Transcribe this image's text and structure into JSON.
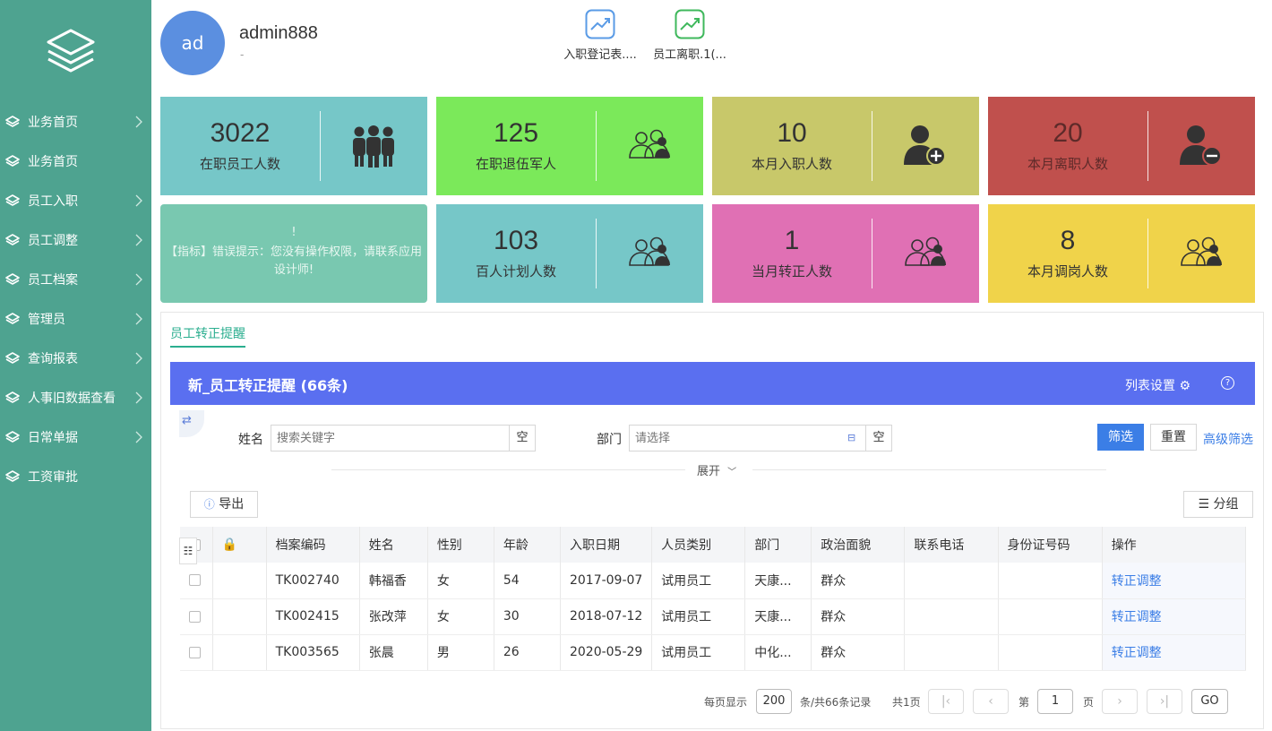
{
  "user": {
    "avatar_text": "ad",
    "name": "admin888",
    "sub": "-"
  },
  "shortcuts": [
    {
      "label": "入职登记表...."
    },
    {
      "label": "员工离职.1(..."
    }
  ],
  "sidebar": {
    "items": [
      {
        "label": "业务首页",
        "has_arrow": true
      },
      {
        "label": "业务首页",
        "has_arrow": false
      },
      {
        "label": "员工入职",
        "has_arrow": true
      },
      {
        "label": "员工调整",
        "has_arrow": true
      },
      {
        "label": "员工档案",
        "has_arrow": true
      },
      {
        "label": "管理员",
        "has_arrow": true
      },
      {
        "label": "查询报表",
        "has_arrow": true
      },
      {
        "label": "人事旧数据查看",
        "has_arrow": true
      },
      {
        "label": "日常单据",
        "has_arrow": true
      },
      {
        "label": "工资审批",
        "has_arrow": false
      }
    ]
  },
  "stats": [
    {
      "value": "3022",
      "label": "在职员工人数",
      "color": "#76c7c8",
      "icon": "group-icon"
    },
    {
      "value": "125",
      "label": "在职退伍军人",
      "color": "#7be95a",
      "icon": "users-outline-icon"
    },
    {
      "value": "10",
      "label": "本月入职人数",
      "color": "#c8c86a",
      "icon": "user-add-icon"
    },
    {
      "value": "20",
      "label": "本月离职人数",
      "color": "#c0504d",
      "icon": "user-remove-icon"
    },
    {
      "value": "103",
      "label": "百人计划人数",
      "color": "#76c7c8",
      "icon": "users-outline-icon"
    },
    {
      "value": "1",
      "label": "当月转正人数",
      "color": "#e070b4",
      "icon": "users-outline-icon"
    },
    {
      "value": "8",
      "label": "本月调岗人数",
      "color": "#f0d34a",
      "icon": "users-outline-icon"
    }
  ],
  "error_card": {
    "mark": "!",
    "text": "【指标】错误提示：您没有操作权限，请联系应用设计师!"
  },
  "panel": {
    "tab": "员工转正提醒",
    "title": "新_员工转正提醒 (66条)",
    "column_settings": "列表设置",
    "help": "?"
  },
  "filters": {
    "name_label": "姓名",
    "name_placeholder": "搜索关键字",
    "clear": "空",
    "dept_label": "部门",
    "dept_placeholder": "请选择",
    "filter_btn": "筛选",
    "reset_btn": "重置",
    "advanced": "高级筛选",
    "expand": "展开"
  },
  "toolbar": {
    "export": "导出",
    "group": "分组"
  },
  "table": {
    "headers": [
      "档案编码",
      "姓名",
      "性别",
      "年龄",
      "入职日期",
      "人员类别",
      "部门",
      "政治面貌",
      "联系电话",
      "身份证号码",
      "操作"
    ],
    "rows": [
      [
        "TK002740",
        "韩福香",
        "女",
        "54",
        "2017-09-07",
        "试用员工",
        "天康...",
        "群众",
        "",
        "",
        "转正调整"
      ],
      [
        "TK002415",
        "张改萍",
        "女",
        "30",
        "2018-07-12",
        "试用员工",
        "天康...",
        "群众",
        "",
        "",
        "转正调整"
      ],
      [
        "TK003565",
        "张晨",
        "男",
        "26",
        "2020-05-29",
        "试用员工",
        "中化...",
        "群众",
        "",
        "",
        "转正调整"
      ]
    ]
  },
  "pager": {
    "per_page_label": "每页显示",
    "per_page": "200",
    "total": "条/共66条记录",
    "pages": "共1页",
    "page_prefix": "第",
    "page": "1",
    "page_suffix": "页",
    "go": "GO"
  }
}
